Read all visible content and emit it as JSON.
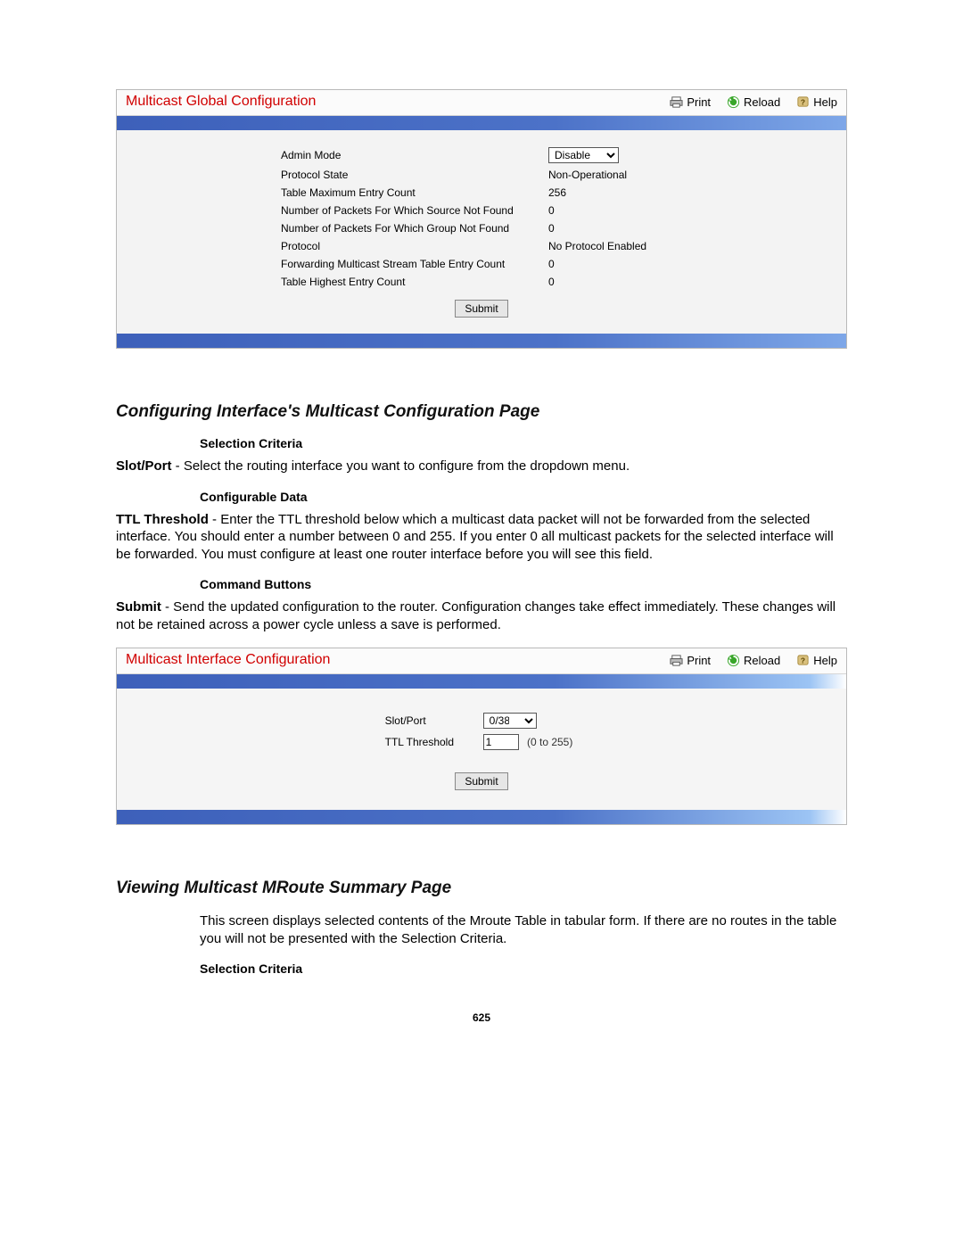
{
  "panel1": {
    "title": "Multicast Global Configuration",
    "actions": {
      "print": "Print",
      "reload": "Reload",
      "help": "Help"
    },
    "rows": [
      {
        "label": "Admin Mode",
        "type": "select",
        "value": "Disable"
      },
      {
        "label": "Protocol State",
        "type": "text",
        "value": "Non-Operational"
      },
      {
        "label": "Table Maximum Entry Count",
        "type": "text",
        "value": "256"
      },
      {
        "label": "Number of Packets For Which Source Not Found",
        "type": "text",
        "value": "0"
      },
      {
        "label": "Number of Packets For Which Group Not Found",
        "type": "text",
        "value": "0"
      },
      {
        "label": "Protocol",
        "type": "text",
        "value": "No Protocol Enabled"
      },
      {
        "label": "Forwarding Multicast Stream Table Entry Count",
        "type": "text",
        "value": "0"
      },
      {
        "label": "Table Highest Entry Count",
        "type": "text",
        "value": "0"
      }
    ],
    "submit": "Submit"
  },
  "section1": {
    "heading": "Configuring Interface's Multicast Configuration Page",
    "sub1": "Selection Criteria",
    "slotport_term": "Slot/Port",
    "slotport_text": " - Select the routing interface you want to configure from the dropdown menu.",
    "sub2": "Configurable Data",
    "ttl_term": "TTL Threshold",
    "ttl_text": " - Enter the TTL threshold below which a multicast data packet will not be forwarded from the selected interface. You should enter a number between 0 and 255. If you enter 0 all multicast packets for the selected interface will be forwarded. You must configure at least one router interface before you will see this field.",
    "sub3": "Command Buttons",
    "submit_term": "Submit",
    "submit_text": " - Send the updated configuration to the router. Configuration changes take effect immediately. These changes will not be retained across a power cycle unless a save is performed."
  },
  "panel2": {
    "title": "Multicast Interface Configuration",
    "actions": {
      "print": "Print",
      "reload": "Reload",
      "help": "Help"
    },
    "slotport_label": "Slot/Port",
    "slotport_value": "0/38",
    "ttl_label": "TTL Threshold",
    "ttl_value": "1",
    "ttl_range": "(0 to 255)",
    "submit": "Submit"
  },
  "section2": {
    "heading": "Viewing Multicast MRoute Summary Page",
    "intro": "This screen displays selected contents of the Mroute Table in tabular form. If there are no routes in the table you will not be presented with the Selection Criteria.",
    "sub1": "Selection Criteria"
  },
  "page_number": "625"
}
